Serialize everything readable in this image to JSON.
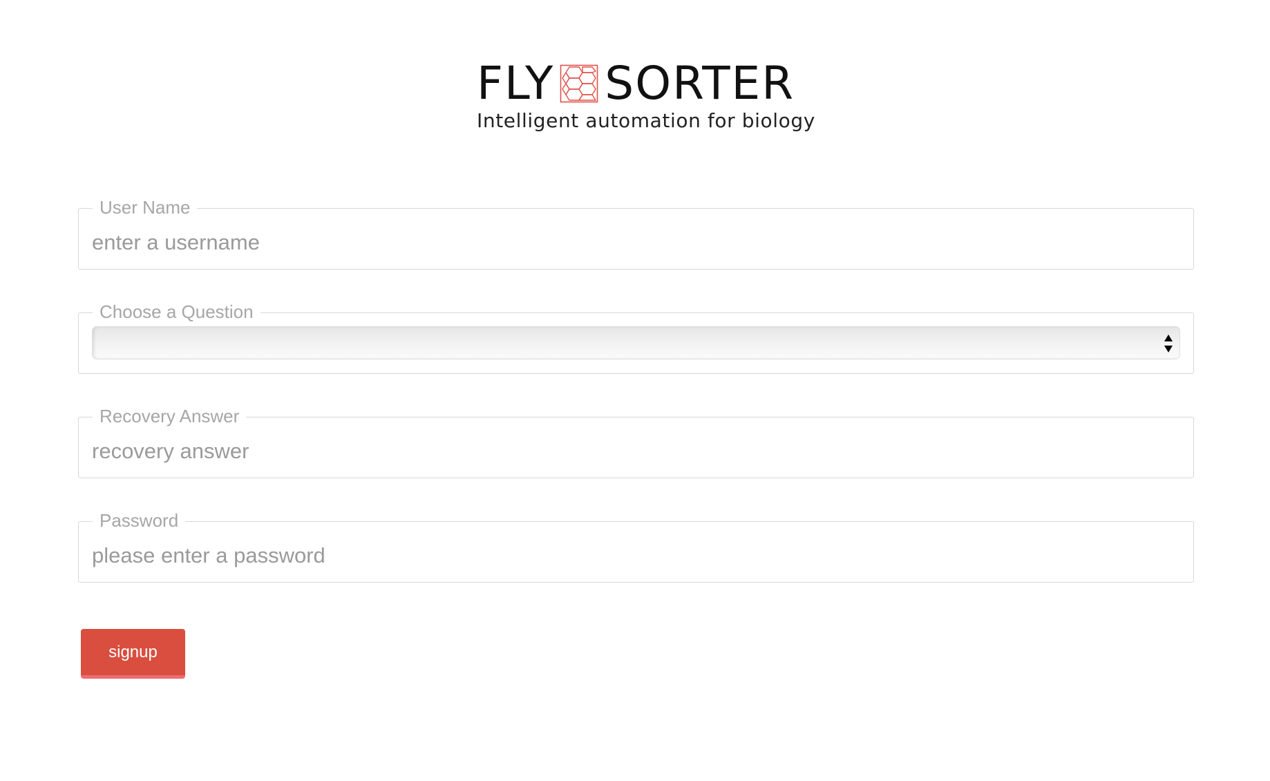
{
  "brand": {
    "name_left": "FLY",
    "name_right": "SORTER",
    "tagline": "Intelligent automation for biology",
    "logo_icon": "honeycomb-cells-icon",
    "accent_color": "#e0514a"
  },
  "form": {
    "username": {
      "label": "User Name",
      "placeholder": "enter a username",
      "value": ""
    },
    "question": {
      "label": "Choose a Question",
      "selected": "",
      "icon": "select-arrows-icon"
    },
    "answer": {
      "label": "Recovery Answer",
      "placeholder": "recovery answer",
      "value": ""
    },
    "password": {
      "label": "Password",
      "placeholder": "please enter a password",
      "value": ""
    },
    "submit_label": "signup",
    "submit_color": "#d94e3f"
  }
}
